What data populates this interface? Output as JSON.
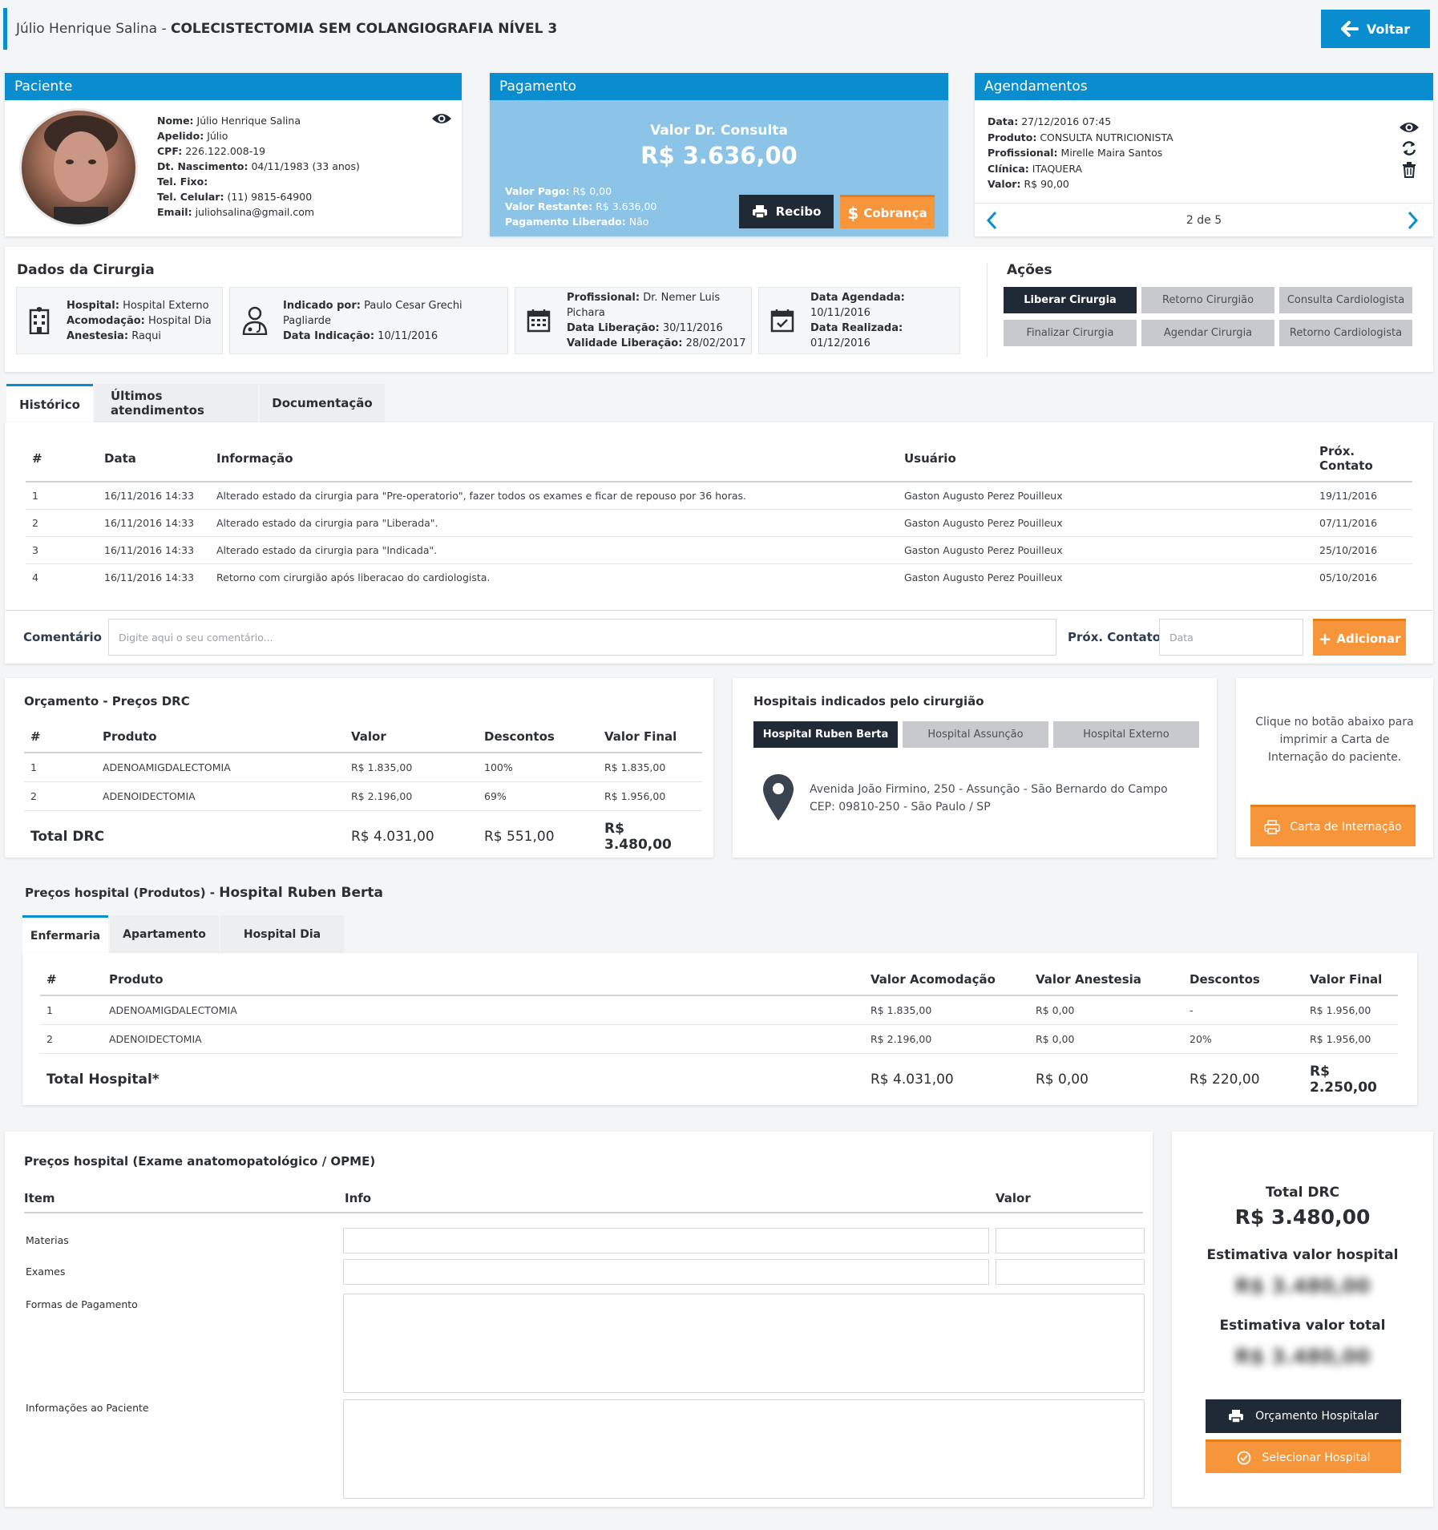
{
  "header": {
    "patient_name": "Júlio Henrique Salina",
    "separator": " - ",
    "procedure": "COLECISTECTOMIA SEM COLANGIOGRAFIA NÍVEL 3",
    "back_label": "Voltar"
  },
  "patient": {
    "title": "Paciente",
    "fields": [
      {
        "label": "Nome:",
        "value": "Júlio Henrique Salina"
      },
      {
        "label": "Apelido:",
        "value": "Júlio"
      },
      {
        "label": "CPF:",
        "value": "226.122.008-19"
      },
      {
        "label": "Dt. Nascimento:",
        "value": "04/11/1983 (33 anos)"
      },
      {
        "label": "Tel. Fixo:",
        "value": ""
      },
      {
        "label": "Tel. Celular:",
        "value": "(11) 9815-64900"
      },
      {
        "label": "Email:",
        "value": "juliohsalina@gmail.com"
      }
    ]
  },
  "payment": {
    "title": "Pagamento",
    "consult_label": "Valor Dr. Consulta",
    "consult_value": "R$ 3.636,00",
    "lines": [
      {
        "label": "Valor Pago:",
        "value": "R$ 0,00"
      },
      {
        "label": "Valor Restante:",
        "value": "R$ 3.636,00"
      },
      {
        "label": "Pagamento Liberado:",
        "value": "Não"
      }
    ],
    "receipt_label": "Recibo",
    "charge_label": "Cobrança"
  },
  "schedule": {
    "title": "Agendamentos",
    "fields": [
      {
        "label": "Data:",
        "value": "27/12/2016 07:45"
      },
      {
        "label": "Produto:",
        "value": "CONSULTA NUTRICIONISTA"
      },
      {
        "label": "Profissional:",
        "value": "Mirelle Maira Santos"
      },
      {
        "label": "Clínica:",
        "value": "ITAQUERA"
      },
      {
        "label": "Valor:",
        "value": "R$ 90,00"
      }
    ],
    "pager": "2 de 5"
  },
  "surgery": {
    "title": "Dados da Cirurgia",
    "box1": [
      {
        "label": "Hospital:",
        "value": "Hospital Externo"
      },
      {
        "label": "Acomodação:",
        "value": "Hospital Dia"
      },
      {
        "label": "Anestesia:",
        "value": "Raqui"
      }
    ],
    "box2": [
      {
        "label": "Indicado por:",
        "value": "Paulo Cesar Grechi Pagliarde"
      },
      {
        "label": "Data Indicação:",
        "value": "10/11/2016"
      }
    ],
    "box3": [
      {
        "label": "Profissional:",
        "value": "Dr. Nemer Luis Pichara"
      },
      {
        "label": "Data Liberação:",
        "value": "30/11/2016"
      },
      {
        "label": "Validade Liberação:",
        "value": "28/02/2017"
      }
    ],
    "box4": [
      {
        "label": "Data Agendada:",
        "value": "10/11/2016"
      },
      {
        "label": "Data Realizada:",
        "value": "01/12/2016"
      }
    ]
  },
  "actions": {
    "title": "Ações",
    "buttons": [
      "Liberar Cirurgia",
      "Retorno Cirurgião",
      "Consulta Cardiologista",
      "Finalizar Cirurgia",
      "Agendar Cirurgia",
      "Retorno Cardiologista"
    ]
  },
  "tabs": [
    "Histórico",
    "Últimos atendimentos",
    "Documentação"
  ],
  "history": {
    "columns": [
      "#",
      "Data",
      "Informação",
      "Usuário",
      "Próx. Contato"
    ],
    "rows": [
      [
        "1",
        "16/11/2016 14:33",
        "Alterado estado da cirurgia para \"Pre-operatorio\", fazer todos os exames e ficar de repouso por 36 horas.",
        "Gaston Augusto Perez Pouilleux",
        "19/11/2016"
      ],
      [
        "2",
        "16/11/2016 14:33",
        "Alterado estado da cirurgia para \"Liberada\".",
        "Gaston Augusto Perez Pouilleux",
        "07/11/2016"
      ],
      [
        "3",
        "16/11/2016 14:33",
        "Alterado estado da cirurgia para \"Indicada\".",
        "Gaston Augusto Perez Pouilleux",
        "25/10/2016"
      ],
      [
        "4",
        "16/11/2016 14:33",
        "Retorno com cirurgião após liberacao do cardiologista.",
        "Gaston Augusto Perez Pouilleux",
        "05/10/2016"
      ]
    ]
  },
  "comment": {
    "label": "Comentário",
    "placeholder": "Digite aqui o seu comentário...",
    "next_label": "Próx. Contato",
    "date_placeholder": "Data",
    "add_label": "Adicionar"
  },
  "budget": {
    "title": "Orçamento - Preços DRC",
    "columns": [
      "#",
      "Produto",
      "Valor",
      "Descontos",
      "Valor Final"
    ],
    "rows": [
      [
        "1",
        "ADENOAMIGDALECTOMIA",
        "R$ 1.835,00",
        "100%",
        "R$ 1.835,00"
      ],
      [
        "2",
        "ADENOIDECTOMIA",
        "R$ 2.196,00",
        "69%",
        "R$ 1.956,00"
      ]
    ],
    "total": [
      "Total DRC",
      "R$ 4.031,00",
      "R$ 551,00",
      "R$ 3.480,00"
    ]
  },
  "hospitals": {
    "title": "Hospitais indicados pelo cirurgião",
    "buttons": [
      "Hospital Ruben Berta",
      "Hospital Assunção",
      "Hospital Externo"
    ],
    "address1": "Avenida João Firmino, 250 - Assunção - São Bernardo do Campo",
    "address2": "CEP: 09810-250 - São Paulo / SP"
  },
  "letter": {
    "text": "Clique no botão abaixo para imprimir a Carta de Internação do paciente.",
    "button": "Carta de Internação"
  },
  "hospital_prices": {
    "title": "Preços hospital (Produtos) - ",
    "hospital": "Hospital Ruben Berta",
    "tabs": [
      "Enfermaria",
      "Apartamento",
      "Hospital Dia"
    ],
    "columns": [
      "#",
      "Produto",
      "Valor Acomodação",
      "Valor Anestesia",
      "Descontos",
      "Valor Final"
    ],
    "rows": [
      [
        "1",
        "ADENOAMIGDALECTOMIA",
        "R$ 1.835,00",
        "R$ 0,00",
        "-",
        "R$ 1.956,00"
      ],
      [
        "2",
        "ADENOIDECTOMIA",
        "R$ 2.196,00",
        "R$ 0,00",
        "20%",
        "R$ 1.956,00"
      ]
    ],
    "total": [
      "Total Hospital*",
      "R$ 4.031,00",
      "R$ 0,00",
      "R$ 220,00",
      "R$ 2.250,00"
    ]
  },
  "opme": {
    "title": "Preços hospital (Exame anatomopatológico / OPME)",
    "columns": [
      "Item",
      "Info",
      "Valor"
    ],
    "rows": [
      "Materias",
      "Exames",
      "Formas de Pagamento",
      "Informações ao Paciente"
    ]
  },
  "summary": {
    "total_drc_label": "Total DRC",
    "total_drc_value": "R$ 3.480,00",
    "est_hospital_label": "Estimativa valor hospital",
    "est_hospital_value": "R$ 3.480,00",
    "est_total_label": "Estimativa valor total",
    "est_total_value": "R$ 3.480,00",
    "budget_button": "Orçamento Hospitalar",
    "select_button": "Selecionar Hospital"
  },
  "colors": {
    "primary": "#0a8dcf",
    "dark": "#1f2a36",
    "orange": "#f7953a",
    "payment_bg": "#8cc4e8"
  }
}
